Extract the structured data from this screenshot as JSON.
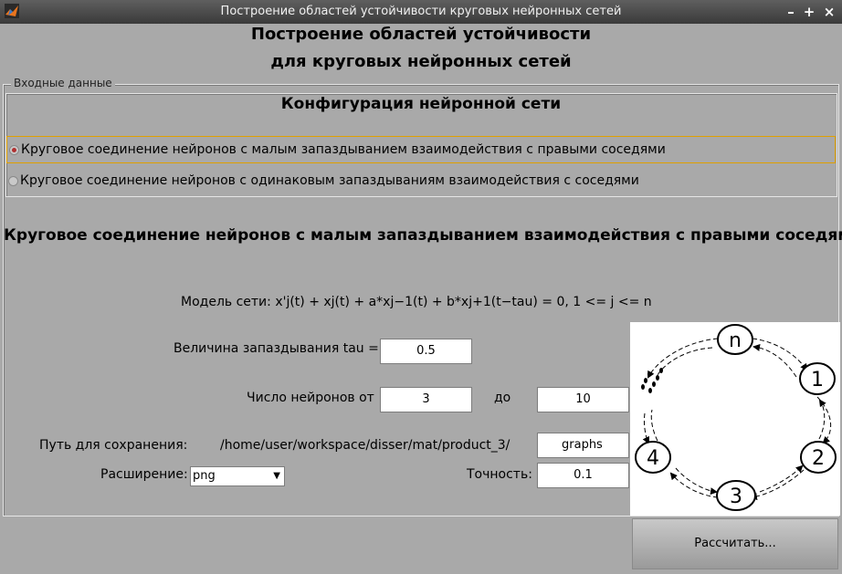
{
  "window": {
    "title": "Построение областей устойчивости круговых нейронных сетей"
  },
  "header": {
    "line1": "Построение областей устойчивости",
    "line2": "для круговых нейронных сетей"
  },
  "input_panel": {
    "legend": "Входные данные",
    "config_title": "Конфигурация нейронной сети",
    "options": [
      {
        "label": "Круговое соединение нейронов с малым запаздыванием взаимодействия с правыми соседями",
        "selected": true
      },
      {
        "label": "Круговое соединение нейронов с одинаковым запаздываниям взаимодействия с соседями",
        "selected": false
      }
    ]
  },
  "selected_title": "Круговое соединение нейронов с малым запаздыванием взаимодействия с правыми соседями",
  "model": "Модель сети: x'j(t) + xj(t) + a*xj−1(t) + b*xj+1(t−tau) = 0, 1 <= j <= n",
  "tau": {
    "label": "Величина запаздывания tau =",
    "value": "0.5"
  },
  "neurons": {
    "from_label": "Число нейронов от",
    "from_value": "3",
    "to_label": "до",
    "to_value": "10"
  },
  "save_path": {
    "label": "Путь для сохранения:",
    "path": "/home/user/workspace/disser/mat/product_3/",
    "folder": "graphs"
  },
  "extension": {
    "label": "Расширение:",
    "value": "png"
  },
  "precision": {
    "label": "Точность:",
    "value": "0.1"
  },
  "diagram": {
    "nodes": [
      "n",
      "1",
      "2",
      "3",
      "4"
    ]
  },
  "calculate_label": "Рассчитать...",
  "colors": {
    "titlebar": "#4a4a4a",
    "background": "#a9a9a9",
    "selected_border": "#e0a000"
  }
}
